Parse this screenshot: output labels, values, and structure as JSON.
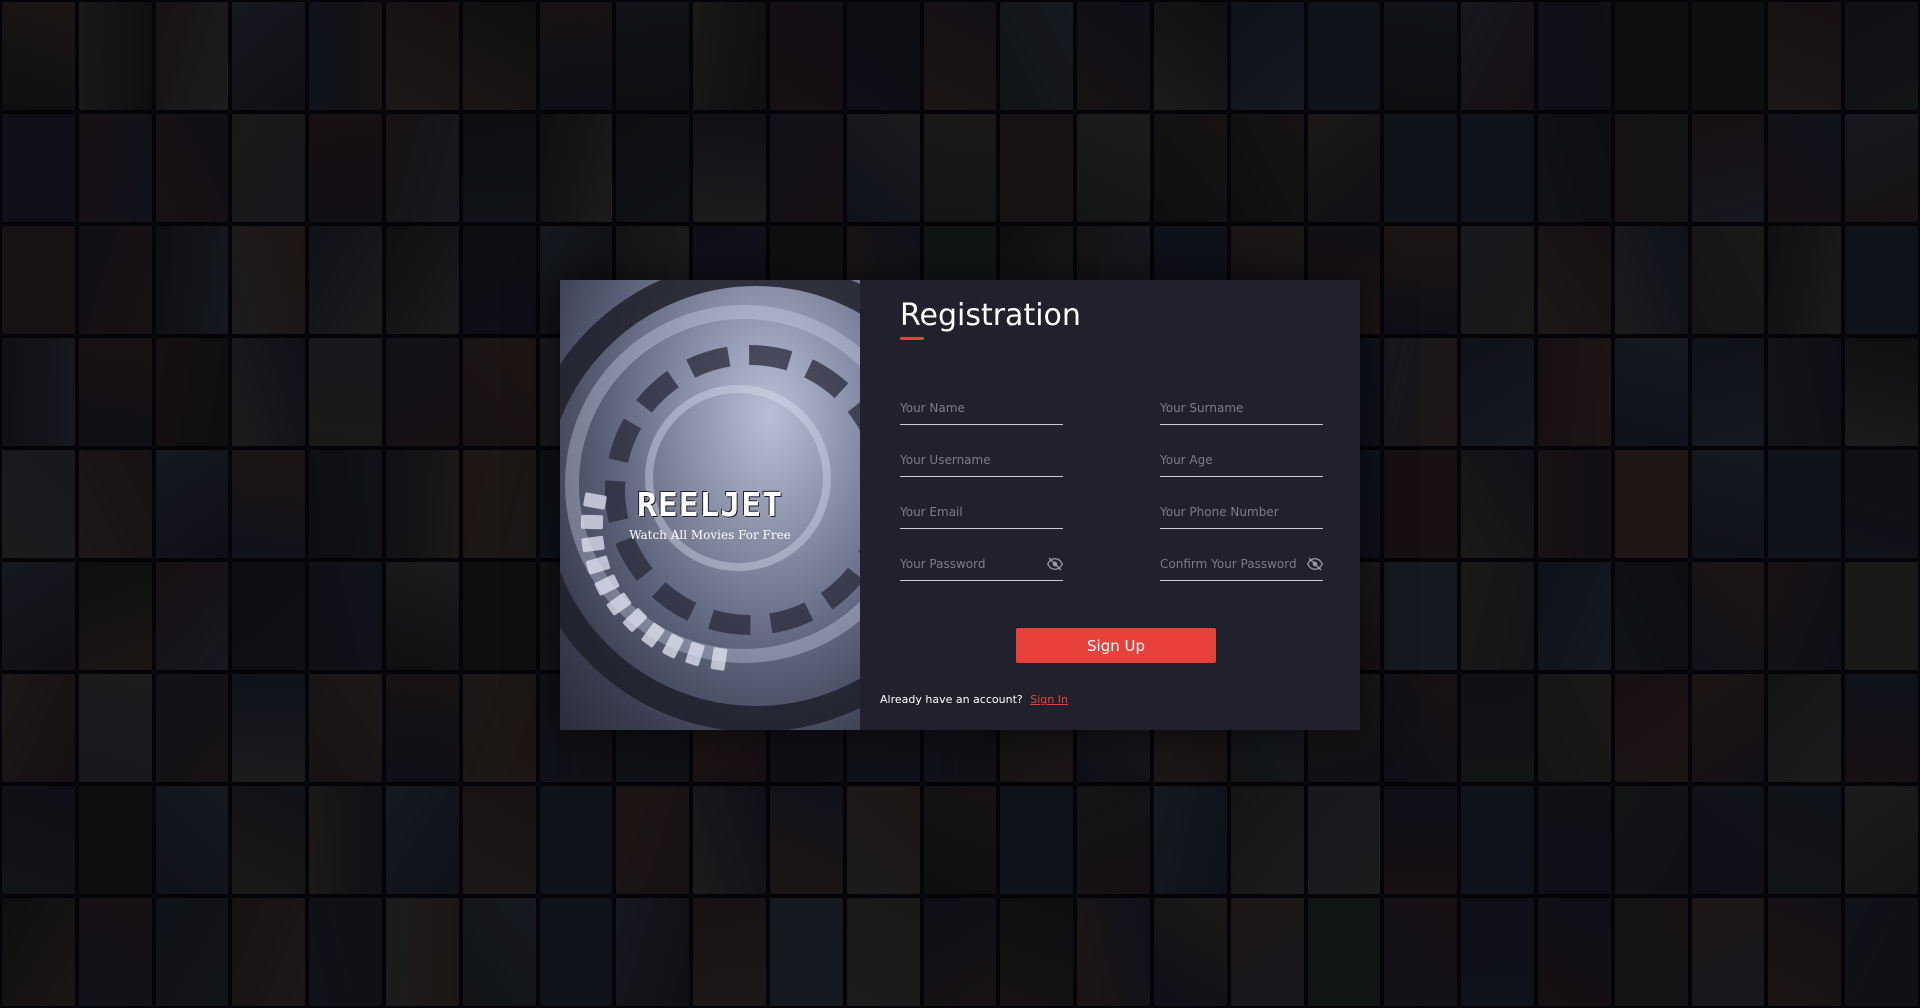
{
  "theme": {
    "accent": "#e8413b",
    "panel_bg": "#21202d",
    "page_bg": "#0d0d12"
  },
  "brand": {
    "logo_text": "REELJET",
    "tagline": "Watch All Movies For Free"
  },
  "registration": {
    "title": "Registration",
    "fields": {
      "name": {
        "placeholder": "Your Name",
        "value": ""
      },
      "surname": {
        "placeholder": "Your Surname",
        "value": ""
      },
      "username": {
        "placeholder": "Your Username",
        "value": ""
      },
      "age": {
        "placeholder": "Your Age",
        "value": ""
      },
      "email": {
        "placeholder": "Your Email",
        "value": ""
      },
      "phone": {
        "placeholder": "Your Phone Number",
        "value": ""
      },
      "password": {
        "placeholder": "Your Password",
        "value": "",
        "icon": "eye-off-icon"
      },
      "confirm_password": {
        "placeholder": "Confirm Your Password",
        "value": "",
        "icon": "eye-off-icon"
      }
    },
    "submit_label": "Sign Up",
    "signin_prompt": "Already have an account?",
    "signin_link": "Sign In"
  },
  "background": {
    "description_icon": "movie-poster-mosaic",
    "poster_colors": [
      "#6b4a3a",
      "#3d4a5c",
      "#7a6a4a",
      "#4a3a4a",
      "#5c6b7a",
      "#2f3b2f",
      "#8a5a3a",
      "#3a4a6a",
      "#6a3a3a",
      "#4a5a4a",
      "#7a7a6a",
      "#3a3a5a"
    ]
  }
}
